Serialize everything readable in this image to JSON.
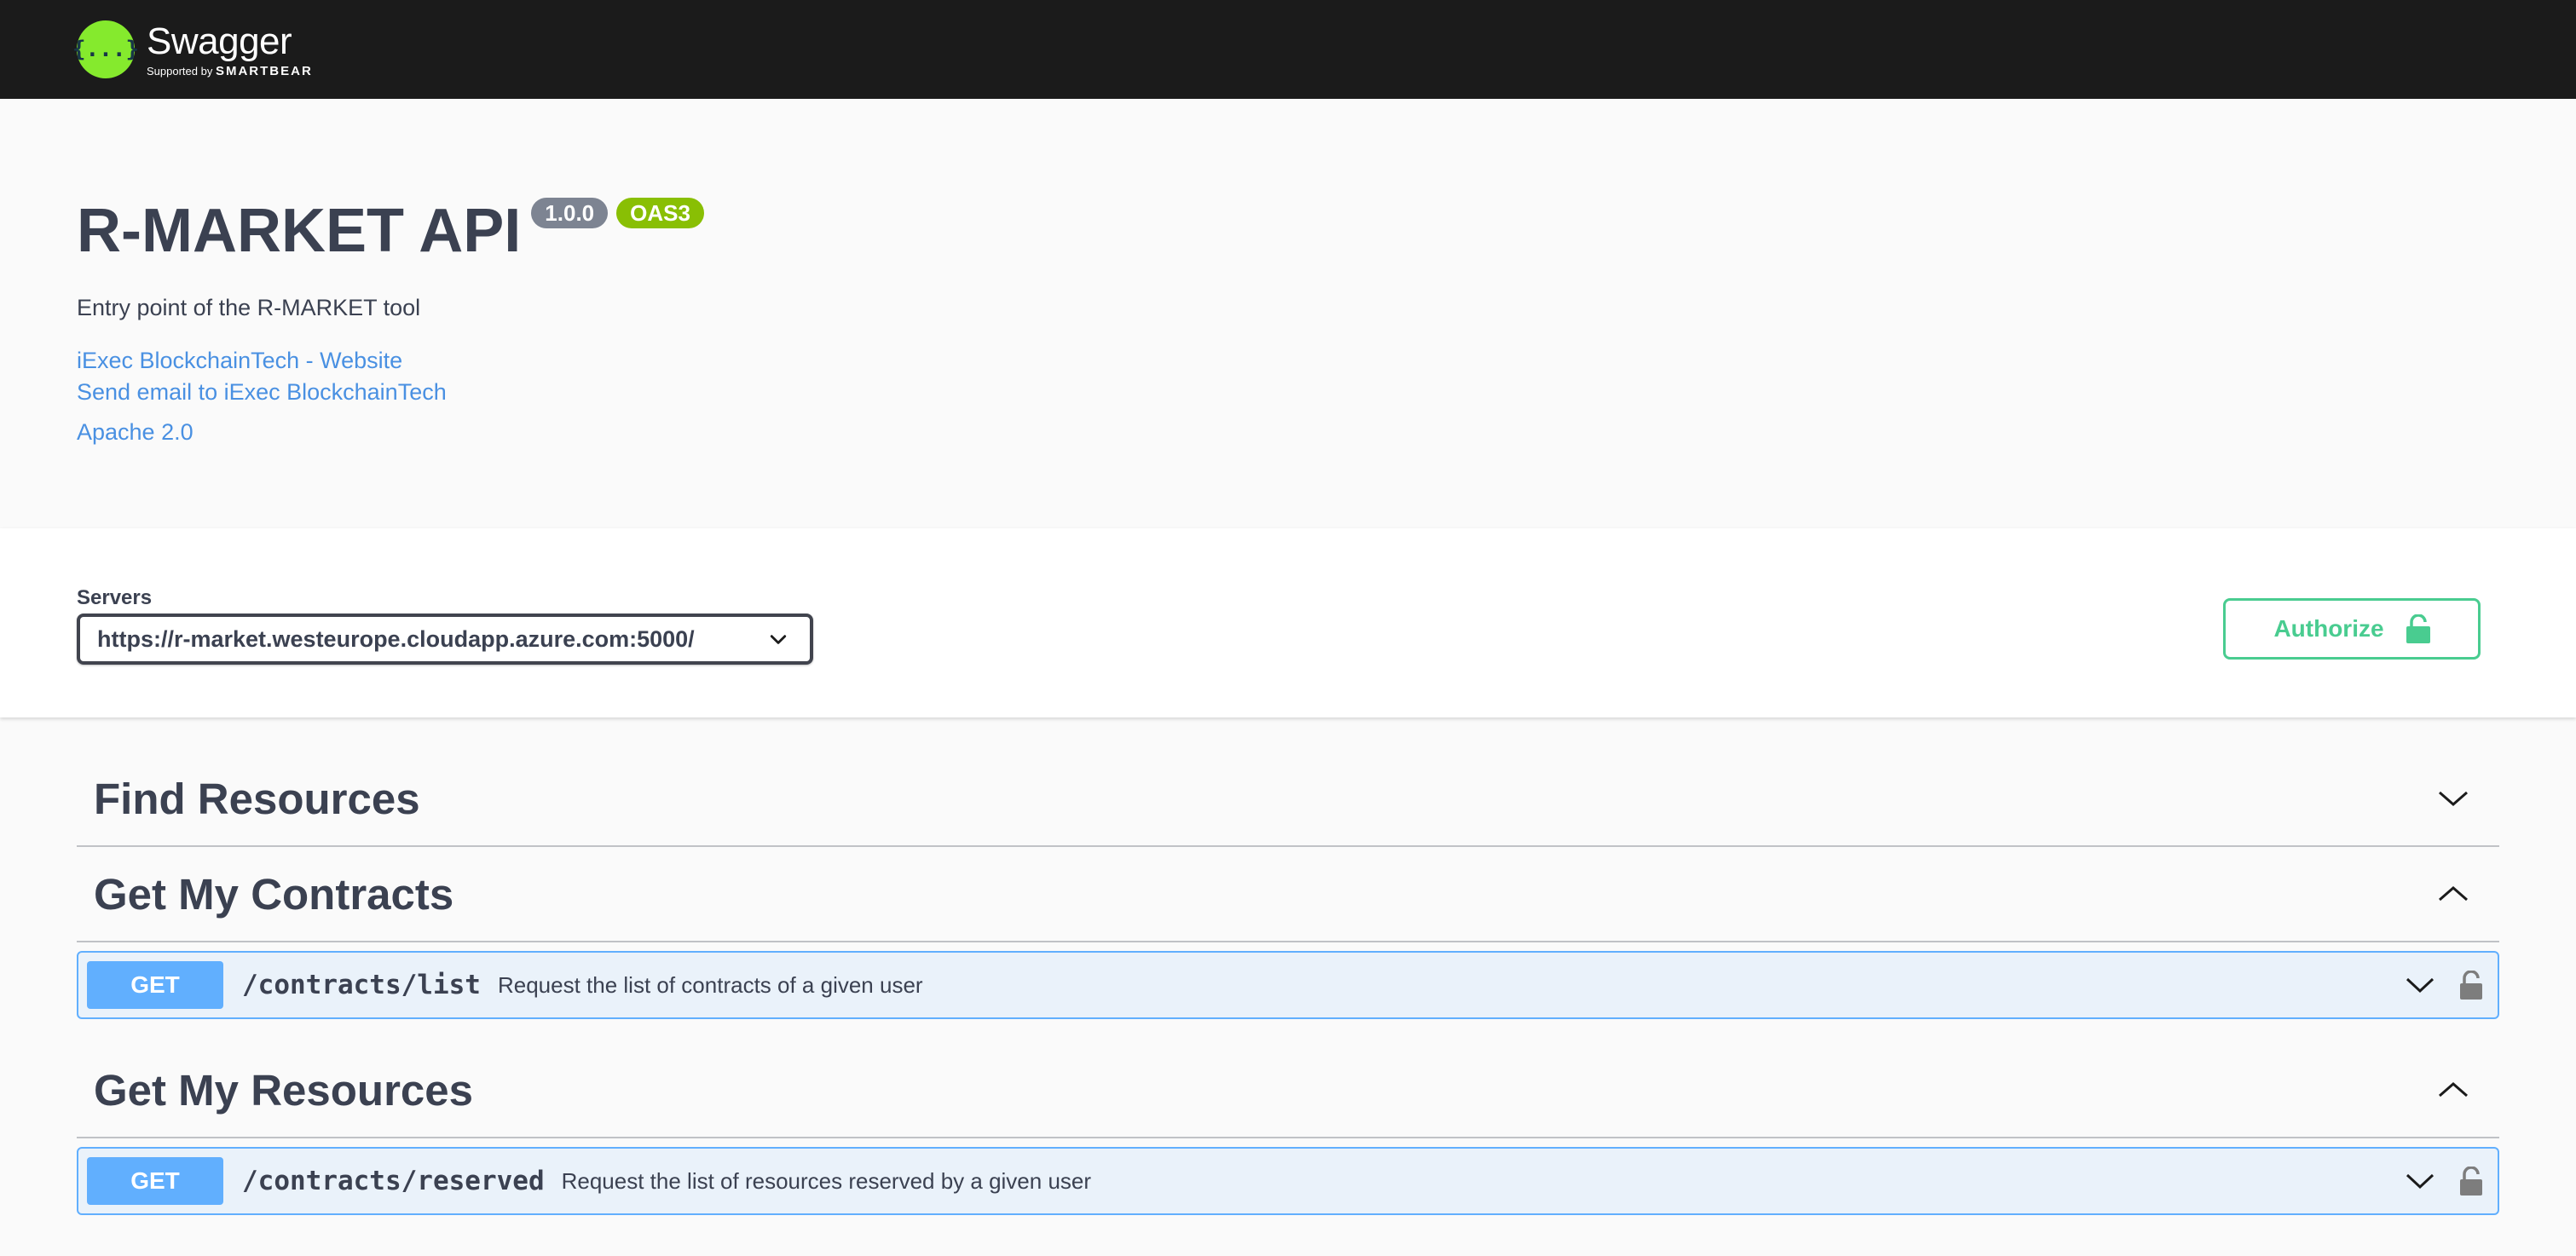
{
  "brand": {
    "logo_glyph": "{...}",
    "name": "Swagger",
    "supported_by": "Supported by",
    "company": "SMARTBEAR"
  },
  "info": {
    "title": "R-MARKET API",
    "version": "1.0.0",
    "oas": "OAS3",
    "description": "Entry point of the R-MARKET tool",
    "website_link": "iExec BlockchainTech - Website",
    "email_link": "Send email to iExec BlockchainTech",
    "license_link": "Apache 2.0"
  },
  "servers": {
    "label": "Servers",
    "selected": "https://r-market.westeurope.cloudapp.azure.com:5000/"
  },
  "authorize": {
    "label": "Authorize"
  },
  "tags": [
    {
      "title": "Find Resources",
      "expanded": false,
      "operations": []
    },
    {
      "title": "Get My Contracts",
      "expanded": true,
      "operations": [
        {
          "method": "GET",
          "path": "/contracts/list",
          "summary": "Request the list of contracts of a given user"
        }
      ]
    },
    {
      "title": "Get My Resources",
      "expanded": true,
      "operations": [
        {
          "method": "GET",
          "path": "/contracts/reserved",
          "summary": "Request the list of resources reserved by a given user"
        }
      ]
    }
  ],
  "colors": {
    "topbar": "#1b1b1b",
    "logo": "#85ea2d",
    "get": "#61affe",
    "authorize": "#49cc90",
    "version_badge": "#7d8492",
    "oas_badge": "#89bf04",
    "link": "#4990e2"
  },
  "icons": [
    "chevron-down-icon",
    "chevron-up-icon",
    "lock-icon",
    "unlock-icon"
  ]
}
